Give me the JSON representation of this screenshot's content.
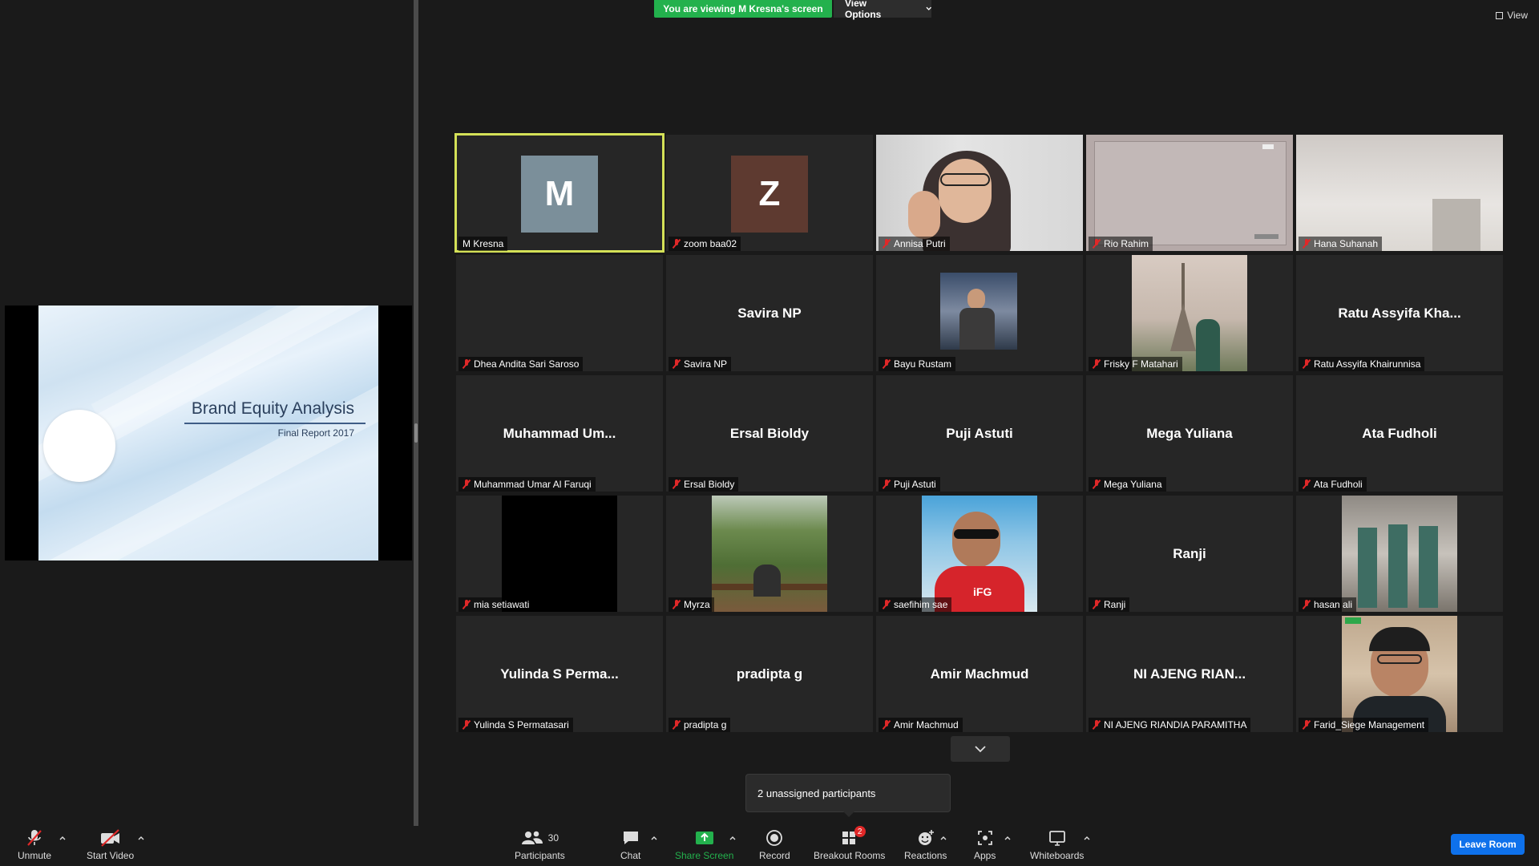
{
  "banner": {
    "viewing": "You are viewing M Kresna's screen",
    "view_options": "View Options",
    "view": "View"
  },
  "slide": {
    "title": "Brand Equity Analysis",
    "subtitle": "Final Report 2017"
  },
  "participants": [
    {
      "name": "M Kresna",
      "center": "",
      "avatar_letter": "M",
      "avatar_color": "#7b8f9a",
      "muted": false,
      "active": true,
      "kind": "avatar"
    },
    {
      "name": "zoom baa02",
      "center": "",
      "avatar_letter": "Z",
      "avatar_color": "#5e3a30",
      "muted": true,
      "active": false,
      "kind": "avatar"
    },
    {
      "name": "Annisa Putri",
      "center": "",
      "muted": true,
      "kind": "photo-annisa"
    },
    {
      "name": "Rio Rahim",
      "center": "",
      "muted": true,
      "kind": "photo-rio"
    },
    {
      "name": "Hana Suhanah",
      "center": "",
      "muted": true,
      "kind": "photo-hana"
    },
    {
      "name": "Dhea Andita Sari Saroso",
      "center": "",
      "muted": true,
      "kind": "blank"
    },
    {
      "name": "Savira NP",
      "center": "Savira NP",
      "muted": true,
      "kind": "text"
    },
    {
      "name": "Bayu Rustam",
      "center": "",
      "muted": true,
      "kind": "photo-bayu"
    },
    {
      "name": "Frisky F Matahari",
      "center": "",
      "muted": true,
      "kind": "photo-frisky"
    },
    {
      "name": "Ratu Assyifa Khairunnisa",
      "center": "Ratu Assyifa Kha...",
      "muted": true,
      "kind": "text"
    },
    {
      "name": "Muhammad Umar Al Faruqi",
      "center": "Muhammad  Um...",
      "muted": true,
      "kind": "text"
    },
    {
      "name": "Ersal Bioldy",
      "center": "Ersal Bioldy",
      "muted": true,
      "kind": "text"
    },
    {
      "name": "Puji Astuti",
      "center": "Puji Astuti",
      "muted": true,
      "kind": "text"
    },
    {
      "name": "Mega Yuliana",
      "center": "Mega Yuliana",
      "muted": true,
      "kind": "text"
    },
    {
      "name": "Ata Fudholi",
      "center": "Ata Fudholi",
      "muted": true,
      "kind": "text"
    },
    {
      "name": "mia setiawati",
      "center": "",
      "muted": true,
      "kind": "photo-mia"
    },
    {
      "name": "Myrza",
      "center": "",
      "muted": true,
      "kind": "photo-myrza"
    },
    {
      "name": "saefihim sae",
      "center": "",
      "muted": true,
      "kind": "photo-saefihim"
    },
    {
      "name": "Ranji",
      "center": "Ranji",
      "muted": true,
      "kind": "text"
    },
    {
      "name": "hasan ali",
      "center": "",
      "muted": true,
      "kind": "photo-hasan"
    },
    {
      "name": "Yulinda S Permatasari",
      "center": "Yulinda S Perma...",
      "muted": true,
      "kind": "text"
    },
    {
      "name": "pradipta g",
      "center": "pradipta g",
      "muted": true,
      "kind": "text"
    },
    {
      "name": "Amir Machmud",
      "center": "Amir Machmud",
      "muted": true,
      "kind": "text"
    },
    {
      "name": "NI AJENG RIANDIA PARAMITHA",
      "center": "NI AJENG RIAN...",
      "muted": true,
      "kind": "text"
    },
    {
      "name": "Farid_Siege Management",
      "center": "",
      "muted": true,
      "kind": "photo-farid"
    }
  ],
  "tooltip": "2 unassigned participants",
  "toolbar": {
    "unmute": "Unmute",
    "start_video": "Start Video",
    "participants": "Participants",
    "participants_count": "30",
    "chat": "Chat",
    "share_screen": "Share Screen",
    "record": "Record",
    "breakout_rooms": "Breakout Rooms",
    "breakout_badge": "2",
    "reactions": "Reactions",
    "apps": "Apps",
    "whiteboards": "Whiteboards",
    "leave_room": "Leave Room"
  },
  "colors": {
    "accent_green": "#23b14d",
    "active_border": "#d4e157",
    "leave_blue": "#0e71eb",
    "muted_red": "#e02828"
  }
}
